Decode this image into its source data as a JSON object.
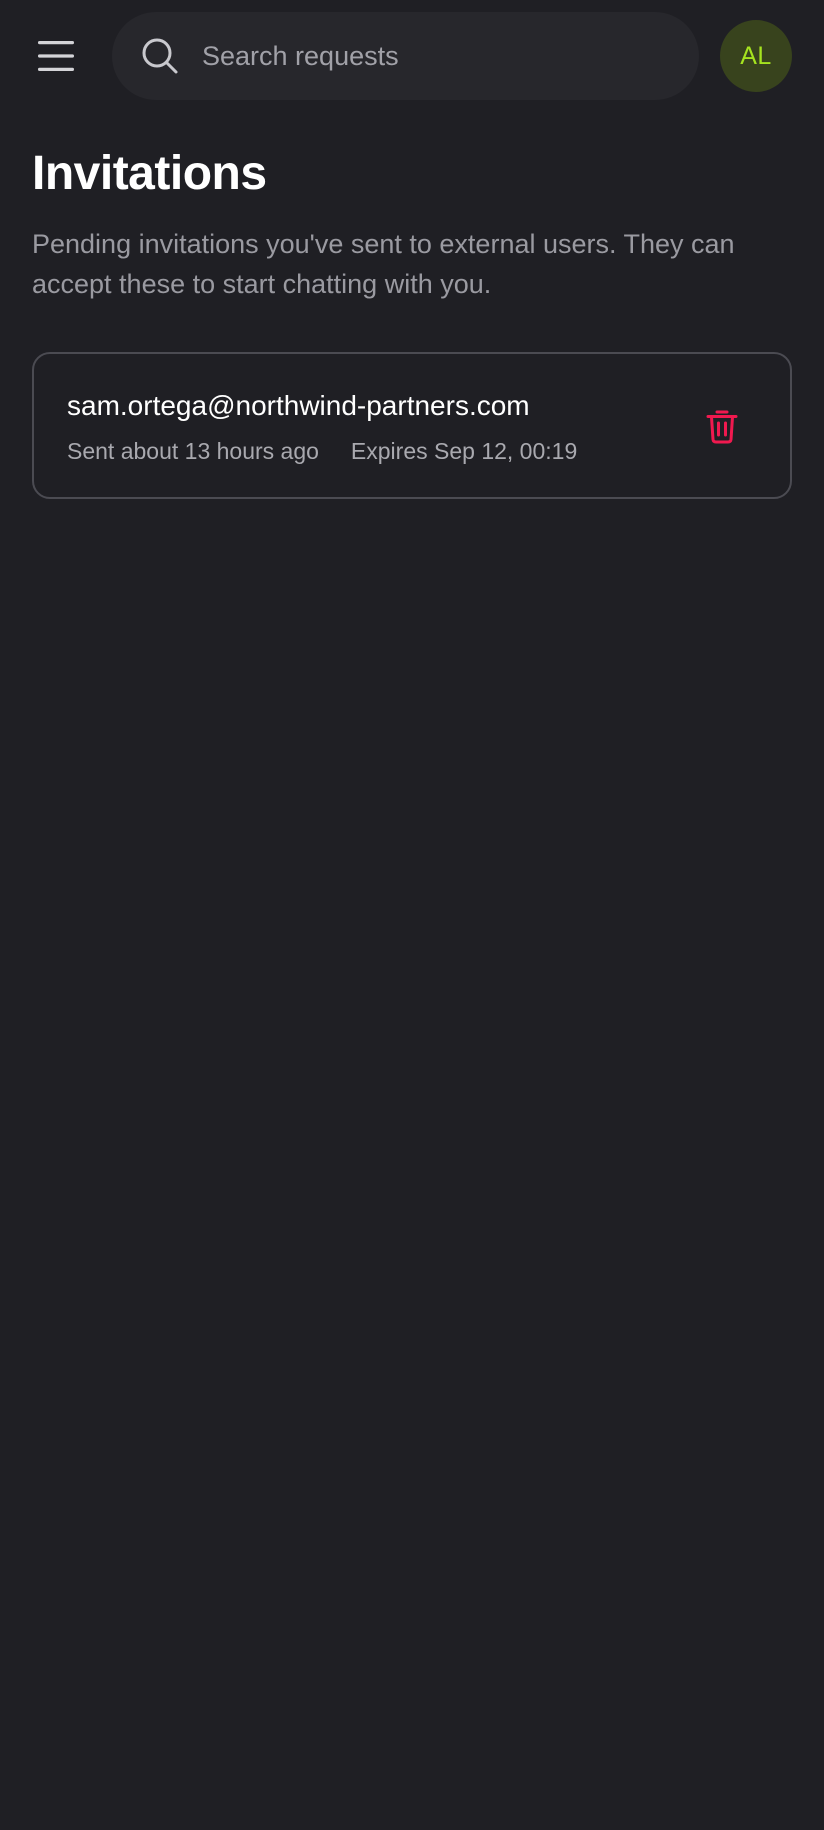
{
  "header": {
    "menu_icon": "hamburger-menu-icon",
    "search": {
      "icon": "search-icon",
      "placeholder": "Search requests",
      "value": ""
    },
    "avatar_initials": "AL"
  },
  "main": {
    "title": "Invitations",
    "description": "Pending invitations you've sent to external users. They can accept these to start chatting with you.",
    "invitations": [
      {
        "email": "sam.ortega@northwind-partners.com",
        "sent": "Sent about 13 hours ago",
        "expires": "Expires Sep 12, 00:19",
        "delete_icon": "trash-icon"
      }
    ]
  },
  "colors": {
    "background": "#1f1f24",
    "search_background": "#27272c",
    "avatar_background": "#38431d",
    "avatar_text": "#a5e31f",
    "danger": "#f0194f",
    "card_border": "#4b4b52"
  }
}
